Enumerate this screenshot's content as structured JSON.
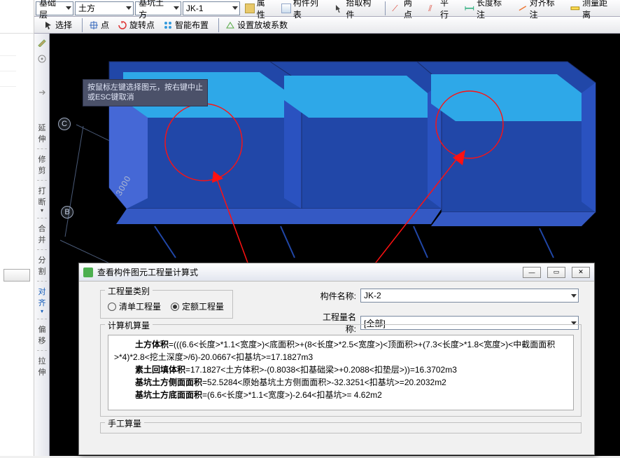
{
  "toolbar1": {
    "dd1": "基础层",
    "dd2": "土方",
    "dd3": "基坑土方",
    "dd4": "JK-1",
    "btn_attr": "属性",
    "btn_list": "构件列表",
    "btn_pick": "拾取构件",
    "btn_two": "两点",
    "btn_par": "平行",
    "btn_dim": "长度标注",
    "btn_align": "对齐标注",
    "btn_meas": "测量距离"
  },
  "toolbar2": {
    "select": "选择",
    "point": "点",
    "rotpoint": "旋转点",
    "smart": "智能布置",
    "slope": "设置放坡系数"
  },
  "tooltip": {
    "line1": "按鼠标左键选择图元，按右键中止",
    "line2": "或ESC键取消"
  },
  "side": {
    "items": [
      "延伸",
      "修剪",
      "打断",
      "合并",
      "分割",
      "对齐",
      "偏移",
      "拉伸"
    ],
    "active_index": 5
  },
  "axes": {
    "C": "C",
    "B": "B",
    "d3000": "3000",
    "d000": "000"
  },
  "panel": {
    "title": "查看构件图元工程量计算式",
    "group1_legend": "工程量类别",
    "radio_bill": "清单工程量",
    "radio_quota": "定额工程量",
    "name_lbl": "构件名称:",
    "name_val": "JK-2",
    "qtyname_lbl": "工程量名称:",
    "qtyname_val": "[全部]",
    "calc_legend": "计算机算量",
    "calc": {
      "l1a": "土方体积",
      "l1b": "=(((6.6<长度>*1.1<宽度>)<底面积>+(8<长度>*2.5<宽度>)<顶面积>+(7.3<长度>*1.8<宽度>)<中截面面积>*4)*2.8<挖土深度>/6)-20.0667<扣基坑>=17.1827m3",
      "l2a": "素土回填体积",
      "l2b": "=17.1827<土方体积>-(0.8038<扣基础梁>+0.2088<扣垫层>))=16.3702m3",
      "l3a": "基坑土方侧面面积",
      "l3b": "=52.5284<原始基坑土方侧面面积>-32.3251<扣基坑>=20.2032m2",
      "l4a": "基坑土方底面面积",
      "l4b": "=(6.6<长度>*1.1<宽度>)-2.64<扣基坑>= 4.62m2"
    },
    "manual_legend": "手工算量"
  }
}
